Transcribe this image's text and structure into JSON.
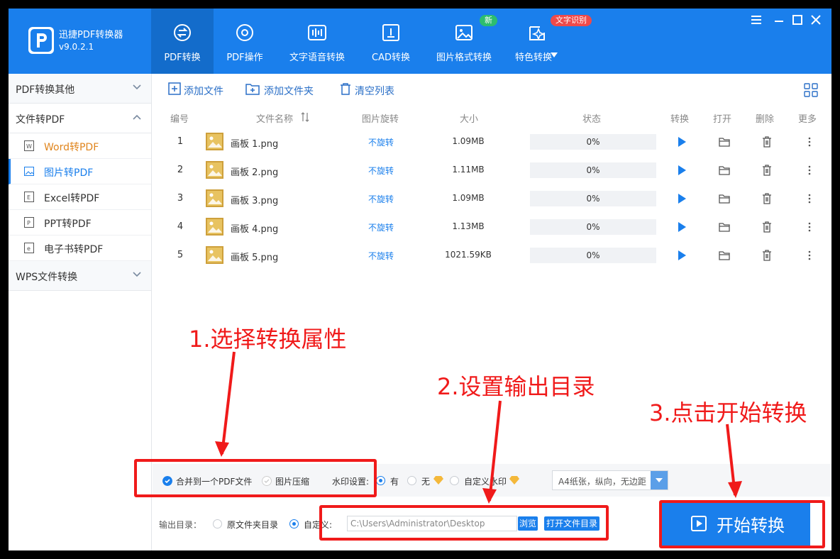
{
  "app": {
    "name": "迅捷PDF转换器",
    "version": "v9.0.2.1"
  },
  "tabs": [
    {
      "label": "PDF转换",
      "active": true
    },
    {
      "label": "PDF操作"
    },
    {
      "label": "文字语音转换"
    },
    {
      "label": "CAD转换"
    },
    {
      "label": "图片格式转换",
      "badge": "新"
    },
    {
      "label": "特色转换",
      "badge": "文字识别"
    }
  ],
  "sidebar": {
    "groups": [
      {
        "label": "PDF转换其他"
      },
      {
        "label": "文件转PDF"
      },
      {
        "label": "WPS文件转换"
      }
    ],
    "items": [
      {
        "label": "Word转PDF"
      },
      {
        "label": "图片转PDF",
        "selected": true
      },
      {
        "label": "Excel转PDF"
      },
      {
        "label": "PPT转PDF"
      },
      {
        "label": "电子书转PDF"
      }
    ]
  },
  "toolbar": {
    "add_file": "添加文件",
    "add_folder": "添加文件夹",
    "clear_list": "清空列表"
  },
  "table": {
    "headers": [
      "编号",
      "文件名称",
      "图片旋转",
      "大小",
      "状态",
      "转换",
      "打开",
      "删除",
      "更多"
    ],
    "rows": [
      {
        "num": "1",
        "name": "画板 1.png",
        "rotate": "不旋转",
        "size": "1.09MB",
        "status": "0%"
      },
      {
        "num": "2",
        "name": "画板 2.png",
        "rotate": "不旋转",
        "size": "1.11MB",
        "status": "0%"
      },
      {
        "num": "3",
        "name": "画板 3.png",
        "rotate": "不旋转",
        "size": "1.09MB",
        "status": "0%"
      },
      {
        "num": "4",
        "name": "画板 4.png",
        "rotate": "不旋转",
        "size": "1.13MB",
        "status": "0%"
      },
      {
        "num": "5",
        "name": "画板 5.png",
        "rotate": "不旋转",
        "size": "1021.59KB",
        "status": "0%"
      }
    ]
  },
  "options": {
    "merge": "合并到一个PDF文件",
    "compress": "图片压缩",
    "watermark_label": "水印设置:",
    "wm_yes": "有",
    "wm_no": "无",
    "wm_custom": "自定义水印",
    "paper": "A4纸张，纵向，无边距",
    "output_label": "输出目录：",
    "out_source": "原文件夹目录",
    "out_custom": "自定义:",
    "path": "C:\\Users\\Administrator\\Desktop",
    "browse": "浏览",
    "open_folder": "打开文件目录"
  },
  "start": "开始转换",
  "annotations": {
    "step1": "1.选择转换属性",
    "step2": "2.设置输出目录",
    "step3": "3.点击开始转换"
  },
  "colors": {
    "primary": "#1a7fec",
    "annotation": "#f01a1a",
    "badge_new": "#2dbd6e",
    "badge_ocr": "#ef4a4a"
  }
}
